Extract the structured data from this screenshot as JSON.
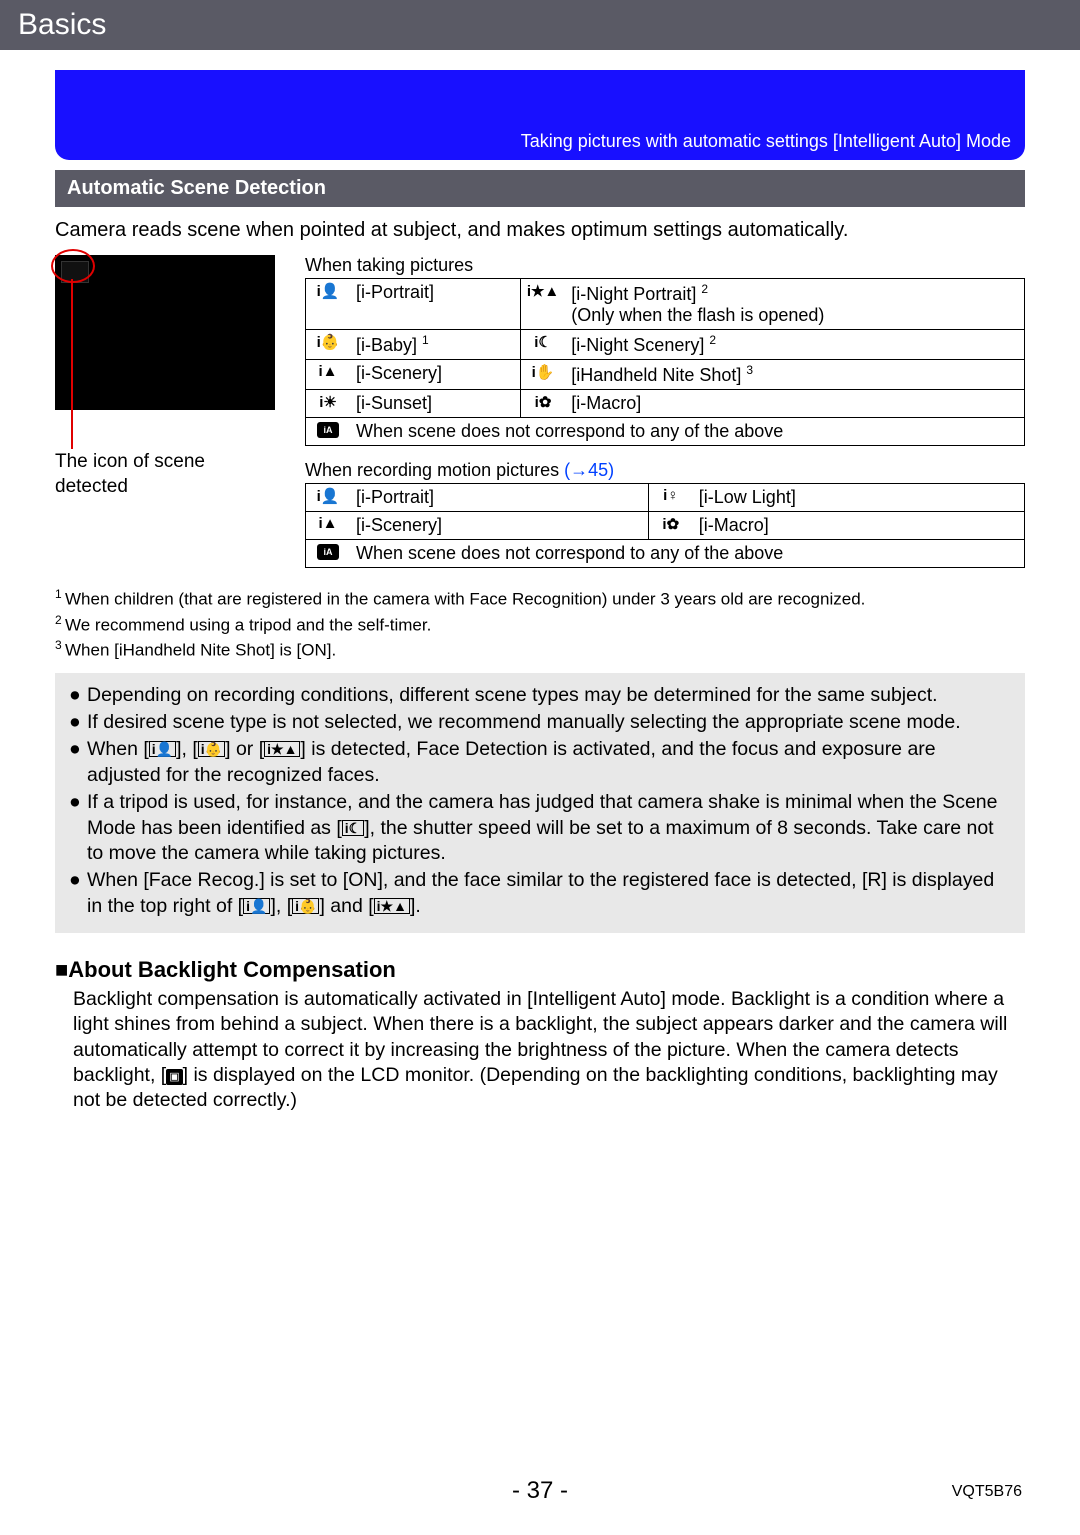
{
  "header": {
    "title": "Basics"
  },
  "banner": {
    "text": "Taking pictures with automatic settings  [Intelligent Auto] Mode"
  },
  "section": {
    "title": "Automatic Scene Detection"
  },
  "intro": "Camera reads scene when pointed at subject, and makes optimum settings automatically.",
  "preview_caption_line1": "The icon of scene",
  "preview_caption_line2": "detected",
  "table1": {
    "title": "When taking pictures",
    "rows": [
      {
        "l_icon": "i👤",
        "l_label": "[i-Portrait]",
        "r_icon": "i★▲",
        "r_label": "[i-Night Portrait]",
        "r_sup": "2",
        "r_extra": "(Only when the flash is opened)"
      },
      {
        "l_icon": "i👶",
        "l_label": "[i-Baby]",
        "l_sup": "1",
        "r_icon": "i☾",
        "r_label": "[i-Night Scenery]",
        "r_sup": "2"
      },
      {
        "l_icon": "i▲",
        "l_label": "[i-Scenery]",
        "r_icon": "i✋",
        "r_label": "[iHandheld Nite Shot]",
        "r_sup": "3"
      },
      {
        "l_icon": "i☀",
        "l_label": "[i-Sunset]",
        "r_icon": "i✿",
        "r_label": "[i-Macro]"
      }
    ],
    "fallback_icon": "iA",
    "fallback": "When scene does not correspond to any of the above"
  },
  "table2": {
    "title_pre": "When recording motion pictures ",
    "title_link": "(→45)",
    "rows": [
      {
        "l_icon": "i👤",
        "l_label": "[i-Portrait]",
        "r_icon": "i♀",
        "r_label": "[i-Low Light]"
      },
      {
        "l_icon": "i▲",
        "l_label": "[i-Scenery]",
        "r_icon": "i✿",
        "r_label": "[i-Macro]"
      }
    ],
    "fallback_icon": "iA",
    "fallback": "When scene does not correspond to any of the above"
  },
  "footnotes": {
    "n1": "When children (that are registered in the camera with Face Recognition) under 3 years old are recognized.",
    "n2": "We recommend using a tripod and the self-timer.",
    "n3": "When [iHandheld Nite Shot] is [ON]."
  },
  "notes": {
    "b1": "Depending on recording conditions, different scene types may be determined for the same subject.",
    "b2": "If desired scene type is not selected, we recommend manually selecting the appropriate scene mode.",
    "b3_pre": "When [",
    "b3_i1": "i👤",
    "b3_mid1": "], [",
    "b3_i2": "i👶",
    "b3_mid2": "] or [",
    "b3_i3": "i★▲",
    "b3_post": "] is detected, Face Detection is activated, and the focus and exposure are adjusted for the recognized faces.",
    "b4_pre": "If a tripod is used, for instance, and the camera has judged that camera shake is minimal when the Scene Mode has been identified as [",
    "b4_i1": "i☾",
    "b4_post": "], the shutter speed will be set to a maximum of 8 seconds. Take care not to move the camera while taking pictures.",
    "b5_pre": "When [Face Recog.] is set to [ON], and the face similar to the registered face is detected, [R] is displayed in the top right of [",
    "b5_i1": "i👤",
    "b5_mid1": "], [",
    "b5_i2": "i👶",
    "b5_mid2": "] and [",
    "b5_i3": "i★▲",
    "b5_post": "]."
  },
  "about": {
    "heading": "■About Backlight Compensation",
    "text_pre": "Backlight compensation is automatically activated in [Intelligent Auto] mode. Backlight is a condition where a light shines from behind a subject. When there is a backlight, the subject appears darker and the camera will automatically attempt to correct it by increasing the brightness of the picture. When the camera detects backlight, [",
    "text_icon": "▣",
    "text_post": "] is displayed on the LCD monitor. (Depending on the backlighting conditions, backlighting may not be detected correctly.)"
  },
  "footer": {
    "page": "- 37 -",
    "docid": "VQT5B76"
  }
}
